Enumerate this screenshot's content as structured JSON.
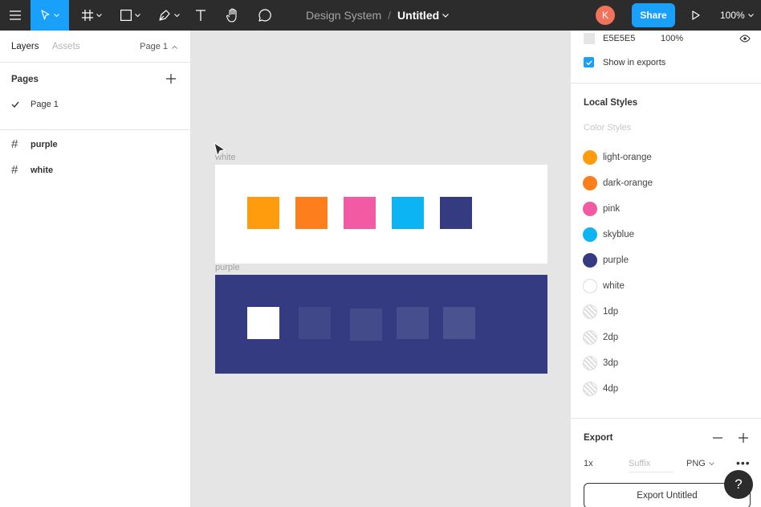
{
  "toolbar": {
    "project": "Design System",
    "separator": "/",
    "file_name": "Untitled",
    "avatar_initial": "K",
    "share_label": "Share",
    "zoom": "100%",
    "accent": "#18a0fb",
    "icons": [
      "menu-icon",
      "move-tool-icon",
      "frame-tool-icon",
      "shape-tool-icon",
      "pen-tool-icon",
      "text-tool-icon",
      "hand-tool-icon",
      "comment-tool-icon",
      "present-icon"
    ]
  },
  "left_panel": {
    "tabs": [
      "Layers",
      "Assets"
    ],
    "page_selector": "Page 1",
    "pages_title": "Pages",
    "pages": [
      "Page 1"
    ],
    "layers": [
      "purple",
      "white"
    ]
  },
  "canvas": {
    "frames": [
      {
        "label": "white",
        "background": "#ffffff",
        "swatches": [
          "#ff9c0e",
          "#fc7e1d",
          "#f25ba3",
          "#0cb4f3",
          "#343b80"
        ]
      },
      {
        "label": "purple",
        "background": "#343b80",
        "swatches": [
          "#ffffff",
          "#40488a",
          "#434b8b",
          "#464e8d",
          "#4a528f"
        ]
      }
    ]
  },
  "right_panel": {
    "fill": {
      "hex": "E5E5E5",
      "opacity": "100%"
    },
    "show_in_exports": "Show in exports",
    "local_styles_title": "Local Styles",
    "color_styles_label": "Color Styles",
    "styles": [
      {
        "name": "light-orange",
        "color": "#ff9c0e"
      },
      {
        "name": "dark-orange",
        "color": "#fc7e1d"
      },
      {
        "name": "pink",
        "color": "#f25ba3"
      },
      {
        "name": "skyblue",
        "color": "#0cb4f3"
      },
      {
        "name": "purple",
        "color": "#343b80"
      },
      {
        "name": "white",
        "color": "#ffffff"
      },
      {
        "name": "1dp",
        "color": "transparent"
      },
      {
        "name": "2dp",
        "color": "transparent"
      },
      {
        "name": "3dp",
        "color": "transparent"
      },
      {
        "name": "4dp",
        "color": "transparent"
      }
    ],
    "export": {
      "title": "Export",
      "scale": "1x",
      "suffix_placeholder": "Suffix",
      "format": "PNG",
      "button": "Export Untitled"
    }
  },
  "help_label": "?"
}
